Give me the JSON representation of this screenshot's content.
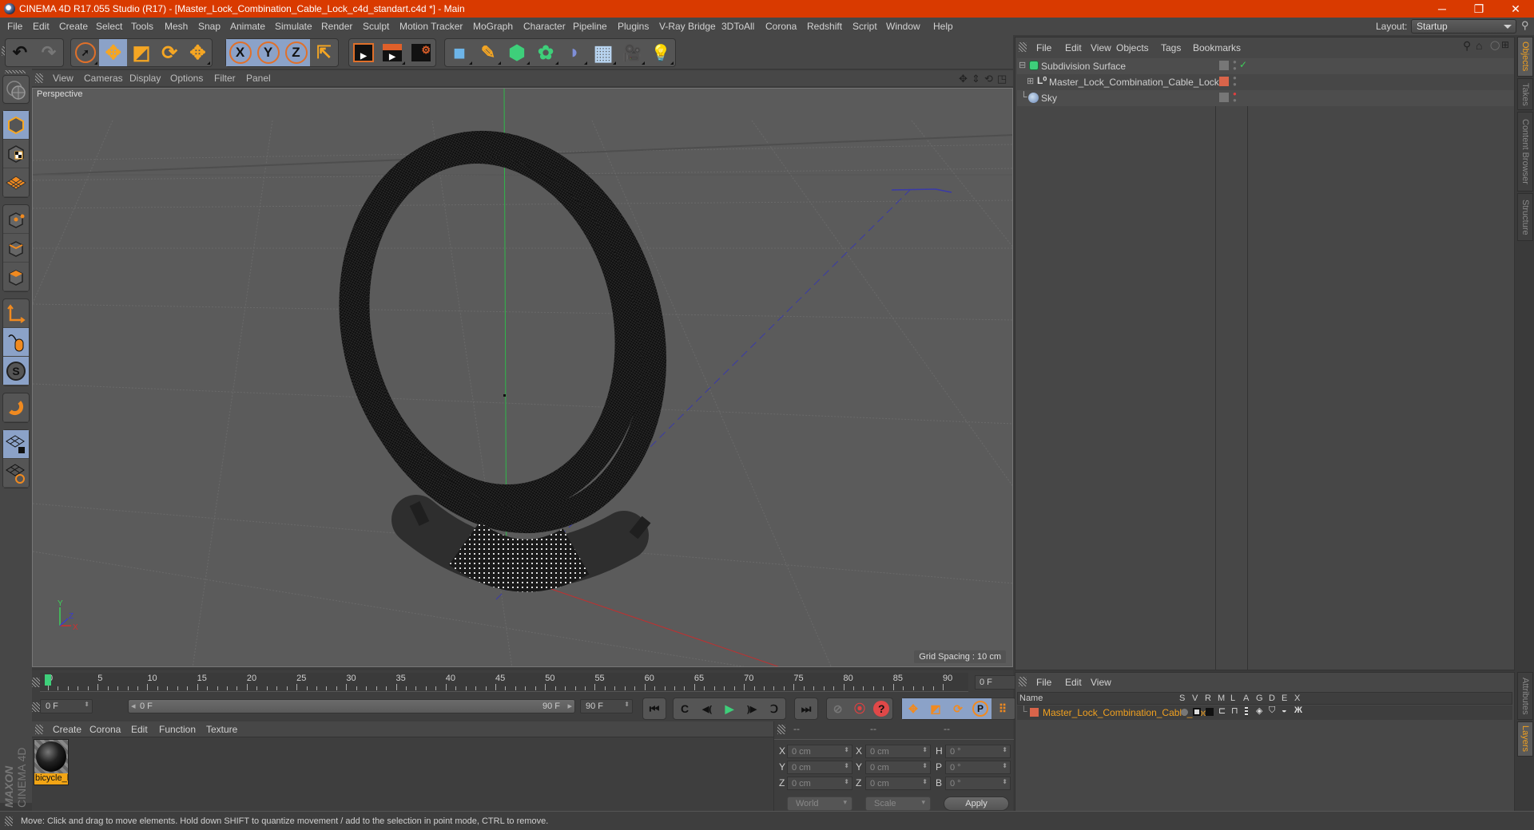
{
  "window": {
    "title": "CINEMA 4D R17.055 Studio (R17) - [Master_Lock_Combination_Cable_Lock_c4d_standart.c4d *] - Main",
    "minimize_icon": "─",
    "restore_icon": "❐",
    "close_icon": "✕"
  },
  "menu": [
    "File",
    "Edit",
    "Create",
    "Select",
    "Tools",
    "Mesh",
    "Snap",
    "Animate",
    "Simulate",
    "Render",
    "Sculpt",
    "Motion Tracker",
    "MoGraph",
    "Character",
    "Pipeline",
    "Plugins",
    "V-Ray Bridge",
    "3DToAll",
    "Corona",
    "Redshift",
    "Script",
    "Window",
    "Help"
  ],
  "layout": {
    "label": "Layout:",
    "value": "Startup",
    "search_icon": "⚲"
  },
  "toolbar": {
    "undo": "↶",
    "redo": "↷",
    "select": "➚",
    "move": "✥",
    "scale": "◩",
    "rotate": "⟳",
    "last_tool": "✥",
    "axis_x": "X",
    "axis_y": "Y",
    "axis_z": "Z",
    "coord_system": "⇱",
    "render_view": "▶",
    "render_pv": "▶",
    "render_settings": "⚙",
    "cube": "■",
    "pen": "✎",
    "subdivision": "⬢",
    "mograph": "✿",
    "deformer": "◗",
    "floor": "▦",
    "camera": "🎥",
    "light": "💡"
  },
  "viewport": {
    "menu": [
      "View",
      "Cameras",
      "Display",
      "Options",
      "Filter",
      "Panel"
    ],
    "label": "Perspective",
    "grid_spacing": "Grid Spacing : 10 cm",
    "nav_icons": [
      "✥",
      "⇕",
      "⟲",
      "◳"
    ],
    "axis": {
      "x": "X",
      "y": "Y",
      "z": "Z"
    }
  },
  "timeline": {
    "ticks": [
      "0",
      "5",
      "10",
      "15",
      "20",
      "25",
      "30",
      "35",
      "40",
      "45",
      "50",
      "55",
      "60",
      "65",
      "70",
      "75",
      "80",
      "85",
      "90"
    ],
    "current_frame": "0 F",
    "start_field": "0 F",
    "range_start": "0 F",
    "range_end": "90 F",
    "end_field": "90 F",
    "playhead_fraction": 0
  },
  "transport": {
    "first": "⏮",
    "prev_key": "C",
    "prev_frame": "◀(",
    "play": "▶",
    "next_frame": ")▶",
    "next_key": "Ↄ",
    "last": "⏭",
    "motion": "⊘",
    "record": "⦿",
    "auto_key": "?",
    "key_move": "✥",
    "key_scale": "◩",
    "key_rotate": "⟳",
    "key_param": "P",
    "key_pla": "⠿",
    "timeline_btn": "▤"
  },
  "materials": {
    "menu": [
      "Create",
      "Corona",
      "Edit",
      "Function",
      "Texture"
    ],
    "items": [
      {
        "name": "bicycle_l"
      }
    ]
  },
  "coordinates": {
    "headers": [
      "--",
      "--",
      "--"
    ],
    "rows": [
      {
        "l1": "X",
        "v1": "0 cm",
        "l2": "X",
        "v2": "0 cm",
        "l3": "H",
        "v3": "0 °"
      },
      {
        "l1": "Y",
        "v1": "0 cm",
        "l2": "Y",
        "v2": "0 cm",
        "l3": "P",
        "v3": "0 °"
      },
      {
        "l1": "Z",
        "v1": "0 cm",
        "l2": "Z",
        "v2": "0 cm",
        "l3": "B",
        "v3": "0 °"
      }
    ],
    "mode": "World",
    "transform": "Scale",
    "apply": "Apply"
  },
  "object_manager": {
    "menu": [
      "File",
      "Edit",
      "View",
      "Objects",
      "Tags",
      "Bookmarks"
    ],
    "objects": [
      {
        "name": "Subdivision Surface",
        "level": 0,
        "expander": "⊟",
        "icon": "subdivision-icon"
      },
      {
        "name": "Master_Lock_Combination_Cable_Lock",
        "level": 1,
        "expander": "⊞",
        "icon": "null-icon"
      },
      {
        "name": "Sky",
        "level": 0,
        "expander": "",
        "icon": "sky-icon"
      }
    ],
    "check": "✓"
  },
  "layer_manager": {
    "menu": [
      "File",
      "Edit",
      "View"
    ],
    "columns": [
      "Name",
      "S",
      "V",
      "R",
      "M",
      "L",
      "A",
      "G",
      "D",
      "E",
      "X"
    ],
    "layers": [
      {
        "name": "Master_Lock_Combination_Cable_Lock",
        "color": "#d9644a"
      }
    ]
  },
  "right_tabs_top": [
    "Objects",
    "Takes",
    "Content Browser",
    "Structure"
  ],
  "right_tabs_bottom": [
    "Attributes",
    "Layers"
  ],
  "status": "Move: Click and drag to move elements. Hold down SHIFT to quantize movement / add to the selection in point mode, CTRL to remove.",
  "brand": {
    "maxon": "MAXON",
    "product": "CINEMA 4D"
  },
  "colors": {
    "title_bar": "#d93a00",
    "selected_tool": "#8ba2c8",
    "accent_orange": "#f0a020",
    "layer_color": "#d9644a"
  }
}
